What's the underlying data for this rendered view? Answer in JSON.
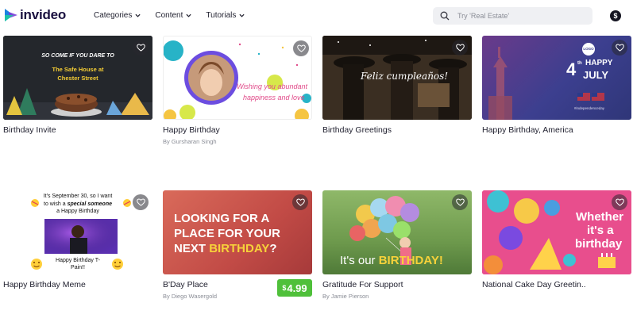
{
  "brand": {
    "name": "invideo"
  },
  "nav": [
    {
      "label": "Categories"
    },
    {
      "label": "Content"
    },
    {
      "label": "Tutorials"
    }
  ],
  "search": {
    "placeholder": "Try 'Real Estate'"
  },
  "account": {
    "currency_symbol": "$"
  },
  "cards": [
    {
      "title": "Birthday Invite",
      "author": "",
      "thumb_text": [
        "SO COME IF YOU DARE TO",
        "The Safe House at",
        "Chester Street"
      ]
    },
    {
      "title": "Happy Birthday",
      "author": "By Gursharan Singh",
      "thumb_text": [
        "Wishing you abundant",
        "happiness and love"
      ]
    },
    {
      "title": "Birthday Greetings",
      "author": "",
      "thumb_text": [
        "Feliz cumpleaños!"
      ]
    },
    {
      "title": "Happy Birthday, America",
      "author": "",
      "thumb_text": [
        "LOGO",
        "4",
        "th",
        "HAPPY",
        "JULY",
        "#independenceday"
      ]
    },
    {
      "title": "Happy Birthday Meme",
      "author": "",
      "thumb_text": [
        "It's September 30, so I want",
        "to wish a",
        "special someone",
        "a Happy Birthday",
        "Happy Birthday T-",
        "Pain!!"
      ]
    },
    {
      "title": "B'Day Place",
      "author": "By Diego Wasergold",
      "price": {
        "symbol": "$",
        "amount": "4.99"
      },
      "thumb_text": [
        "LOOKING FOR A",
        "PLACE FOR YOUR",
        "NEXT",
        "BIRTHDAY",
        "?"
      ]
    },
    {
      "title": "Gratitude For Support",
      "author": "By Jamie Pierson",
      "thumb_text": [
        "It's our",
        "BIRTHDAY!"
      ]
    },
    {
      "title": "National Cake Day Greetin..",
      "author": "",
      "thumb_text": [
        "Whether",
        "it's a",
        "birthday"
      ]
    }
  ],
  "colors": {
    "accent_blue": "#1a82e0",
    "price_green": "#4fc03a",
    "brand_dark": "#1a1140"
  }
}
